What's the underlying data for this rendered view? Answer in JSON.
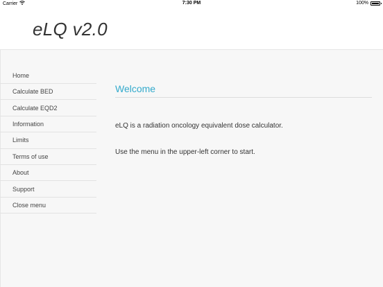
{
  "status_bar": {
    "carrier": "Carrier",
    "wifi_icon": "wifi-icon",
    "time": "7:30 PM",
    "battery_percent": "100%",
    "battery_level": 1.0
  },
  "header": {
    "title": "eLQ v2.0"
  },
  "sidebar": {
    "items": [
      {
        "label": "Home"
      },
      {
        "label": "Calculate BED"
      },
      {
        "label": "Calculate EQD2"
      },
      {
        "label": "Information"
      },
      {
        "label": "Limits"
      },
      {
        "label": "Terms of use"
      },
      {
        "label": "About"
      },
      {
        "label": "Support"
      },
      {
        "label": "Close menu"
      }
    ]
  },
  "main": {
    "heading": "Welcome",
    "paragraph1": "eLQ is a radiation oncology equivalent dose calculator.",
    "paragraph2": "Use the menu in the upper-left corner to start."
  },
  "colors": {
    "accent": "#33aacc",
    "background": "#f7f7f7",
    "header_background": "#ffffff"
  }
}
